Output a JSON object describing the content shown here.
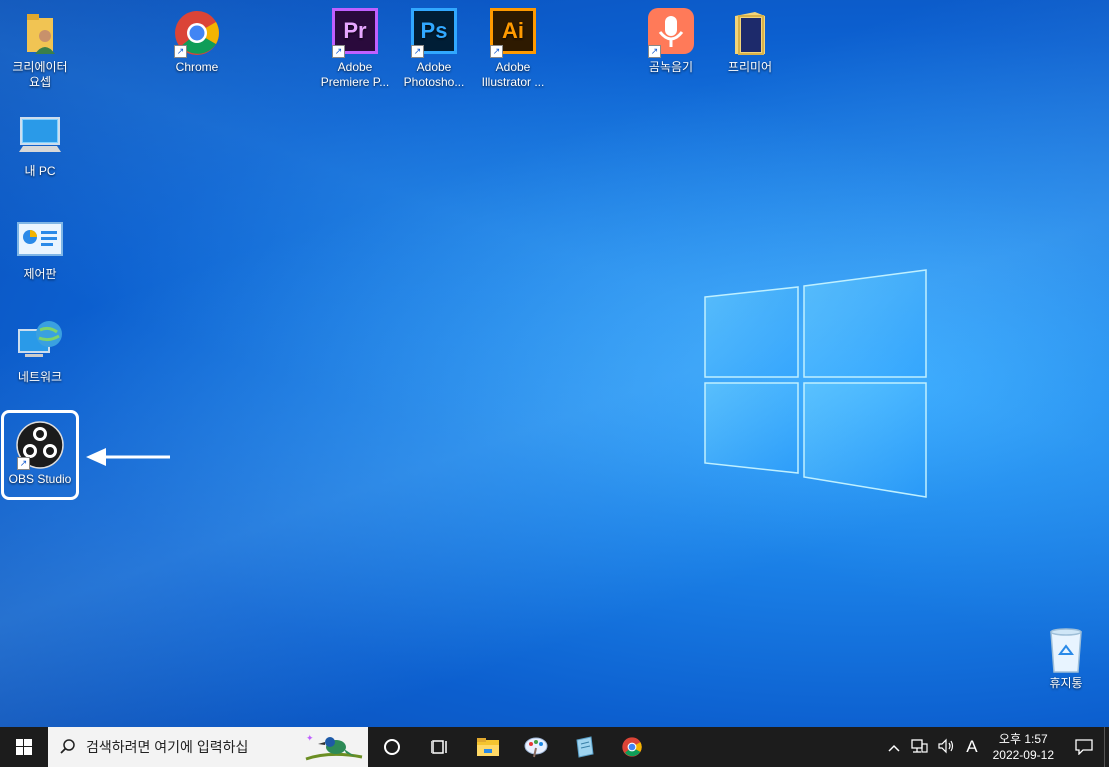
{
  "desktop": {
    "icons": [
      {
        "name": "creator-folder",
        "label": "크리에이터\n요셉"
      },
      {
        "name": "chrome",
        "label": "Chrome"
      },
      {
        "name": "premiere",
        "label": "Adobe\nPremiere P...",
        "badge": "Pr"
      },
      {
        "name": "photoshop",
        "label": "Adobe\nPhotosho...",
        "badge": "Ps"
      },
      {
        "name": "illustrator",
        "label": "Adobe\nIllustrator ...",
        "badge": "Ai"
      },
      {
        "name": "gomrecorder",
        "label": "곰녹음기"
      },
      {
        "name": "premiere-folder",
        "label": "프리미어"
      },
      {
        "name": "my-pc",
        "label": "내 PC"
      },
      {
        "name": "control-panel",
        "label": "제어판"
      },
      {
        "name": "network",
        "label": "네트워크"
      },
      {
        "name": "obs-studio",
        "label": "OBS Studio"
      },
      {
        "name": "recycle-bin",
        "label": "휴지통"
      }
    ]
  },
  "taskbar": {
    "search_placeholder": "검색하려면 여기에 입력하십",
    "ime": "A",
    "time": "오후 1:57",
    "date": "2022-09-12"
  },
  "colors": {
    "desktop_accent": "#1a7fe6",
    "taskbar": "#1c1c1c",
    "premiere": "#2a0a3c",
    "photoshop": "#001e36",
    "illustrator": "#2e1a00"
  }
}
